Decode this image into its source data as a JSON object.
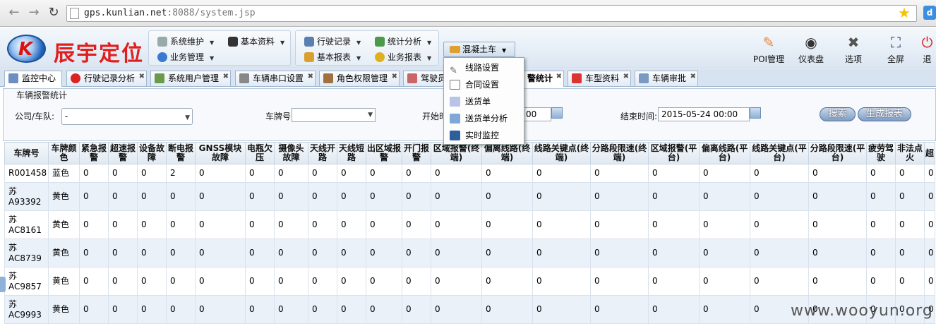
{
  "browser": {
    "url_host": "gps.kunlian.net",
    "url_rest": ":8088/system.jsp"
  },
  "app": {
    "logo_text": "辰宇定位",
    "menus": {
      "system_maint": "系统维护",
      "basic_data": "基本资料",
      "business_mgmt": "业务管理",
      "trip_record": "行驶记录",
      "stat_analysis": "统计分析",
      "basic_report": "基本报表",
      "business_report": "业务报表",
      "concrete_truck": "混凝土车"
    },
    "tools": [
      "POI管理",
      "仪表盘",
      "选项",
      "全屏",
      "退"
    ]
  },
  "tabs": [
    "监控中心",
    "行驶记录分析",
    "系统用户管理",
    "车辆串口设置",
    "角色权限管理",
    "驾驶员",
    "警统计",
    "车型资料",
    "车辆审批"
  ],
  "panel": {
    "title": "车辆报警统计",
    "company_label": "公司/车队:",
    "company_value": "-",
    "plate_label": "车牌号",
    "start_label": "开始时",
    "start_value": "00",
    "end_label": "结束时间:",
    "end_value": "2015-05-24 00:00",
    "search_btn": "搜索",
    "report_btn": "生成报表"
  },
  "dropdown": [
    "线路设置",
    "合同设置",
    "送货单",
    "送货单分析",
    "实时监控"
  ],
  "table": {
    "headers": [
      "车牌号",
      "车牌颜色",
      "紧急报警",
      "超速报警",
      "设备故障",
      "断电报警",
      "GNSS模块故障",
      "电瓶欠压",
      "摄像头故障",
      "天线开路",
      "天线短路",
      "出区域报警",
      "开门报警",
      "区域报警(终端)",
      "偏离线路(终端)",
      "线路关键点(终端)",
      "分路段限速(终端)",
      "区域报警(平台)",
      "偏离线路(平台)",
      "线路关键点(平台)",
      "分路段限速(平台)",
      "疲劳驾驶",
      "非法点火",
      "超"
    ],
    "rows": [
      [
        "R001458",
        "蓝色",
        "0",
        "0",
        "0",
        "2",
        "0",
        "0",
        "0",
        "0",
        "0",
        "0",
        "0",
        "0",
        "0",
        "0",
        "0",
        "0",
        "0",
        "0",
        "0",
        "0",
        "0",
        "0"
      ],
      [
        "苏A93392",
        "黄色",
        "0",
        "0",
        "0",
        "0",
        "0",
        "0",
        "0",
        "0",
        "0",
        "0",
        "0",
        "0",
        "0",
        "0",
        "0",
        "0",
        "0",
        "0",
        "0",
        "0",
        "0",
        "0"
      ],
      [
        "苏AC8161",
        "黄色",
        "0",
        "0",
        "0",
        "0",
        "0",
        "0",
        "0",
        "0",
        "0",
        "0",
        "0",
        "0",
        "0",
        "0",
        "0",
        "0",
        "0",
        "0",
        "0",
        "0",
        "0",
        "0"
      ],
      [
        "苏AC8739",
        "黄色",
        "0",
        "0",
        "0",
        "0",
        "0",
        "0",
        "0",
        "0",
        "0",
        "0",
        "0",
        "0",
        "0",
        "0",
        "0",
        "0",
        "0",
        "0",
        "0",
        "0",
        "0",
        "0"
      ],
      [
        "苏AC9857",
        "黄色",
        "0",
        "0",
        "0",
        "0",
        "0",
        "0",
        "0",
        "0",
        "0",
        "0",
        "0",
        "0",
        "0",
        "0",
        "0",
        "0",
        "0",
        "0",
        "0",
        "0",
        "0",
        "0"
      ],
      [
        "苏AC9993",
        "黄色",
        "0",
        "0",
        "0",
        "0",
        "0",
        "0",
        "0",
        "0",
        "0",
        "0",
        "0",
        "0",
        "0",
        "0",
        "0",
        "0",
        "0",
        "0",
        "0",
        "0",
        "0",
        "0"
      ]
    ]
  },
  "watermark": "www.wooyun.org"
}
